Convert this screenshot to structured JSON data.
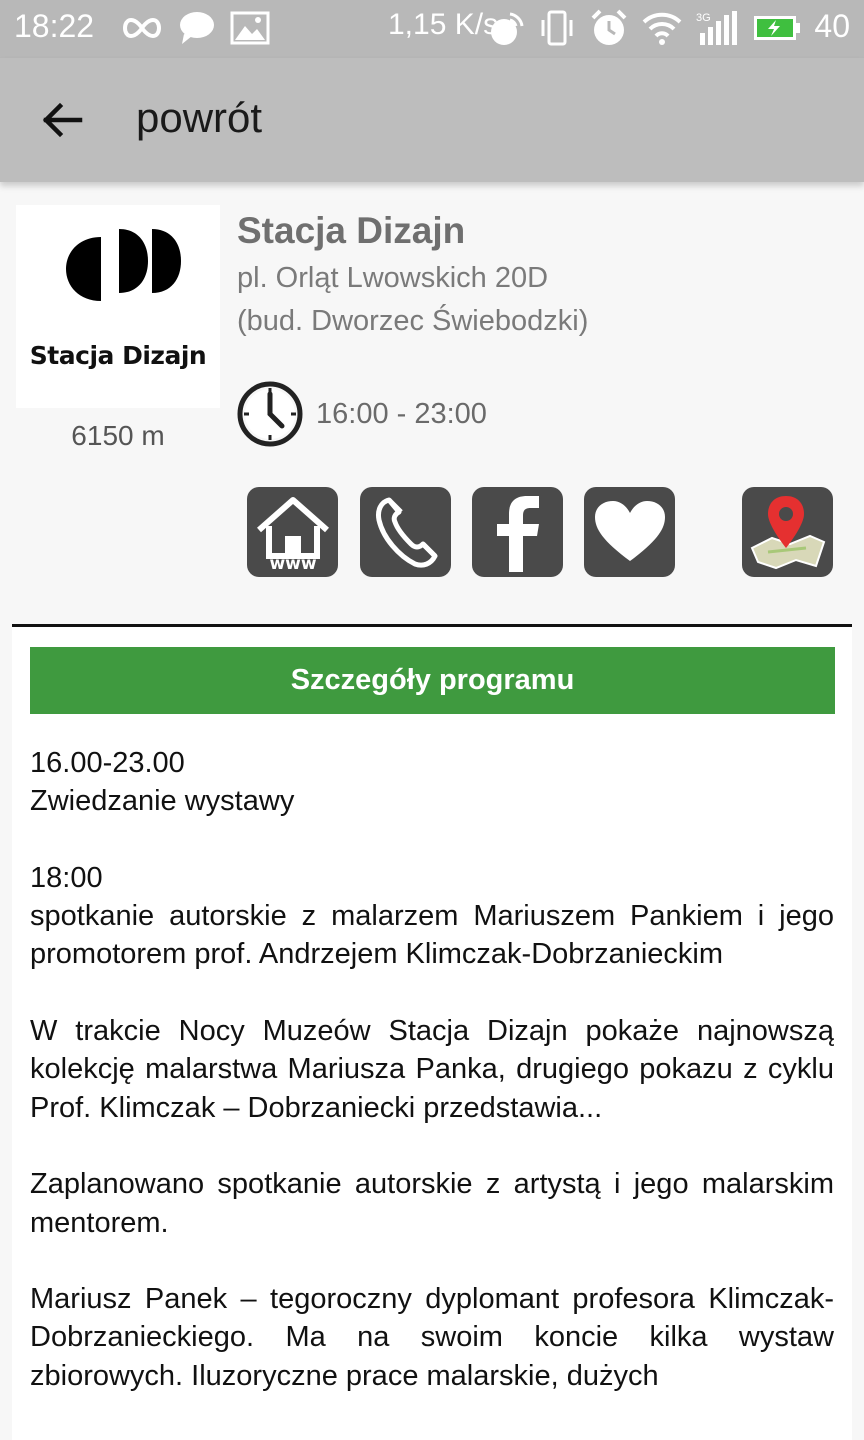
{
  "status_bar": {
    "time": "18:22",
    "net_speed": "1,15 K/s",
    "battery_level": "40",
    "icons": [
      "infinity-icon",
      "chat-bubble-icon",
      "image-icon",
      "hotspot-icon",
      "vibrate-icon",
      "alarm-icon",
      "wifi-icon",
      "signal-3g-icon",
      "battery-charging-icon"
    ],
    "battery_color": "#3fbf3f"
  },
  "app_bar": {
    "back_label": "powrót"
  },
  "place": {
    "logo_text": "Stacja Dizajn",
    "name": "Stacja Dizajn",
    "address_line1": "pl. Orląt Lwowskich 20D",
    "address_line2": "(bud. Dworzec Świebodzki)",
    "distance": "6150 m",
    "hours": "16:00 - 23:00"
  },
  "actions": {
    "www_label": "www",
    "icons": [
      "www-home-icon",
      "phone-icon",
      "facebook-icon",
      "heart-icon",
      "map-pin-icon"
    ]
  },
  "program": {
    "header": "Szczegóły programu",
    "accent_color": "#3f9a3f",
    "lines": [
      "16.00-23.00",
      "Zwiedzanie wystawy",
      "18:00",
      "spotkanie autorskie z malarzem Mariuszem Pankiem i jego promotorem prof. Andrzejem Klimczak-Dobrzanieckim",
      "W trakcie Nocy Muzeów Stacja Dizajn pokaże najnowszą kolekcję malarstwa Mariusza Panka, drugiego pokazu z cyklu Prof. Klimczak – Dobrzaniecki przedstawia...",
      "Zaplanowano spotkanie autorskie z artystą i jego malarskim mentorem.",
      "Mariusz Panek – tegoroczny dyplomant profesora Klimczak-Dobrzanieckiego. Ma na swoim koncie kilka wystaw zbiorowych. Iluzoryczne prace malarskie, dużych"
    ]
  }
}
